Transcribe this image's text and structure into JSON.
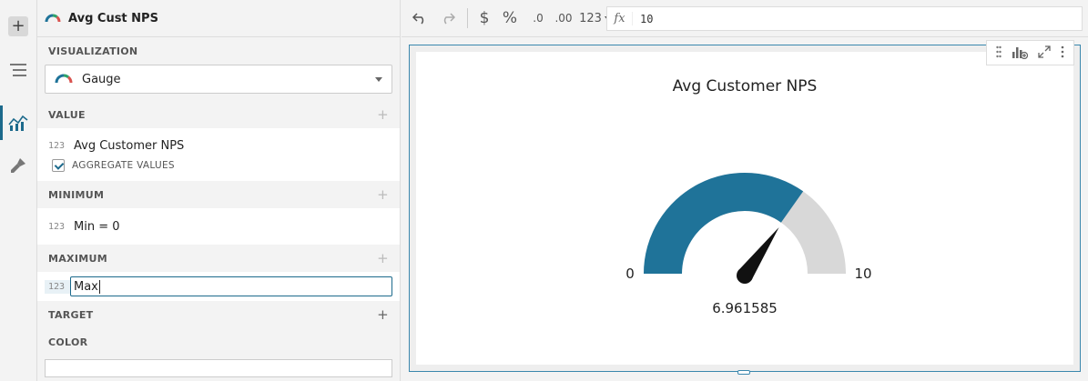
{
  "panel": {
    "title": "Avg Cust NPS",
    "visualization": {
      "label": "VISUALIZATION",
      "selected": "Gauge"
    },
    "value": {
      "label": "VALUE",
      "type": "123",
      "field": "Avg Customer NPS",
      "aggregate_label": "AGGREGATE VALUES"
    },
    "minimum": {
      "label": "MINIMUM",
      "type": "123",
      "field": "Min = 0"
    },
    "maximum": {
      "label": "MAXIMUM",
      "type": "123",
      "input_value": "Max"
    },
    "target": {
      "label": "TARGET"
    },
    "color": {
      "label": "COLOR"
    }
  },
  "toolbar": {
    "undo_icon": "undo-icon",
    "redo_icon": "redo-icon",
    "currency": "$",
    "percent": "%",
    "decimal_decrease": ".0",
    "decimal_increase": ".00",
    "number_format": "123",
    "fx_label": "fx",
    "formula": "10"
  },
  "chart_data": {
    "type": "gauge",
    "title": "Avg Customer NPS",
    "value": 6.961585,
    "min": 0,
    "max": 10,
    "value_label": "6.961585",
    "min_label": "0",
    "max_label": "10",
    "colors": {
      "fill": "#1f7399",
      "track": "#d8d8d8",
      "needle": "#111111"
    }
  }
}
